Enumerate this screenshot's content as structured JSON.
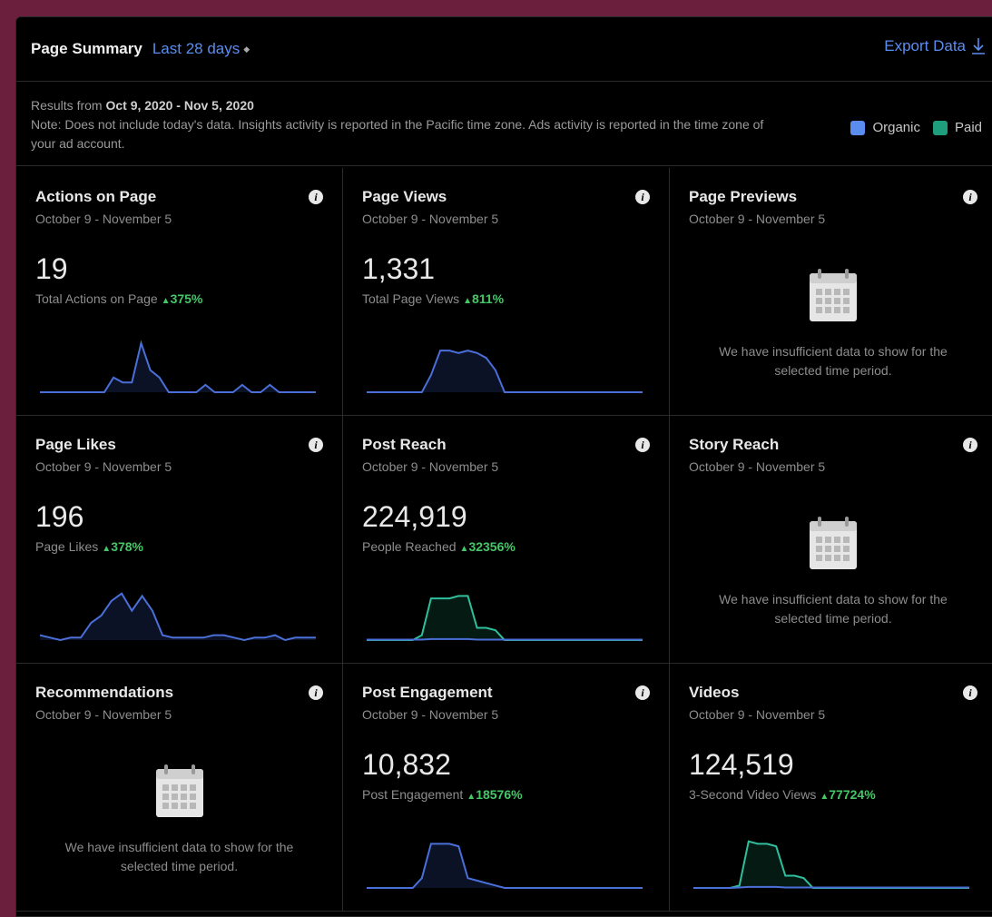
{
  "header": {
    "title": "Page Summary",
    "range_label": "Last 28 days",
    "export_label": "Export Data"
  },
  "notes": {
    "results_prefix": "Results from",
    "results_range": "Oct 9, 2020 - Nov 5, 2020",
    "note": "Note: Does not include today's data. Insights activity is reported in the Pacific time zone. Ads activity is reported in the time zone of your ad account."
  },
  "legend": [
    {
      "label": "Organic",
      "color": "#5b8def"
    },
    {
      "label": "Paid",
      "color": "#1e9e7d"
    }
  ],
  "colors": {
    "organic": "#4a6fd8",
    "paid": "#2fbf9d",
    "positive": "#44c767"
  },
  "cards": [
    {
      "title": "Actions on Page",
      "date": "October 9 - November 5",
      "value": "19",
      "metric": "Total Actions on Page",
      "change": "375%",
      "series": {
        "organic": [
          0,
          0,
          0,
          0,
          0,
          0,
          0,
          0,
          0.3,
          0.2,
          0.2,
          1,
          0.45,
          0.3,
          0,
          0,
          0,
          0,
          0.15,
          0,
          0,
          0,
          0.15,
          0,
          0,
          0.15,
          0,
          0,
          0,
          0,
          0
        ]
      }
    },
    {
      "title": "Page Views",
      "date": "October 9 - November 5",
      "value": "1,331",
      "metric": "Total Page Views",
      "change": "811%",
      "series": {
        "organic": [
          0,
          0,
          0,
          0,
          0,
          0,
          0,
          0.35,
          0.85,
          0.85,
          0.8,
          0.85,
          0.8,
          0.7,
          0.45,
          0,
          0,
          0,
          0,
          0,
          0,
          0,
          0,
          0,
          0,
          0,
          0,
          0,
          0,
          0,
          0
        ]
      }
    },
    {
      "title": "Page Previews",
      "date": "October 9 - November 5",
      "empty": "We have insufficient data to show for the selected time period."
    },
    {
      "title": "Page Likes",
      "date": "October 9 - November 5",
      "value": "196",
      "metric": "Page Likes",
      "change": "378%",
      "series": {
        "organic": [
          0.1,
          0.05,
          0,
          0.05,
          0.05,
          0.35,
          0.5,
          0.8,
          0.95,
          0.6,
          0.9,
          0.6,
          0.1,
          0.05,
          0.05,
          0.05,
          0.05,
          0.1,
          0.1,
          0.05,
          0,
          0.05,
          0.05,
          0.1,
          0,
          0.05,
          0.05,
          0.05
        ]
      }
    },
    {
      "title": "Post Reach",
      "date": "October 9 - November 5",
      "value": "224,919",
      "metric": "People Reached",
      "change": "32356%",
      "series": {
        "paid": [
          0,
          0,
          0,
          0,
          0,
          0,
          0.1,
          0.85,
          0.85,
          0.85,
          0.9,
          0.9,
          0.25,
          0.25,
          0.2,
          0,
          0,
          0,
          0,
          0,
          0,
          0,
          0,
          0,
          0,
          0,
          0,
          0,
          0,
          0,
          0
        ],
        "organic": [
          0.01,
          0.01,
          0.01,
          0.01,
          0.01,
          0.01,
          0.01,
          0.02,
          0.02,
          0.02,
          0.02,
          0.02,
          0.01,
          0.01,
          0.01,
          0.01,
          0.01,
          0.01,
          0.01,
          0.01,
          0.01,
          0.01,
          0.01,
          0.01,
          0.01,
          0.01,
          0.01,
          0.01,
          0.01,
          0.01,
          0.01
        ]
      }
    },
    {
      "title": "Story Reach",
      "date": "October 9 - November 5",
      "empty": "We have insufficient data to show for the selected time period."
    },
    {
      "title": "Recommendations",
      "date": "October 9 - November 5",
      "empty": "We have insufficient data to show for the selected time period."
    },
    {
      "title": "Post Engagement",
      "date": "October 9 - November 5",
      "value": "10,832",
      "metric": "Post Engagement",
      "change": "18576%",
      "series": {
        "organic": [
          0,
          0,
          0,
          0,
          0,
          0,
          0.2,
          0.9,
          0.9,
          0.9,
          0.85,
          0.2,
          0.15,
          0.1,
          0.05,
          0,
          0,
          0,
          0,
          0,
          0,
          0,
          0,
          0,
          0,
          0,
          0,
          0,
          0,
          0,
          0
        ]
      }
    },
    {
      "title": "Videos",
      "date": "October 9 - November 5",
      "value": "124,519",
      "metric": "3-Second Video Views",
      "change": "77724%",
      "series": {
        "paid": [
          0,
          0,
          0,
          0,
          0,
          0.05,
          0.95,
          0.9,
          0.9,
          0.85,
          0.25,
          0.25,
          0.2,
          0,
          0,
          0,
          0,
          0,
          0,
          0,
          0,
          0,
          0,
          0,
          0,
          0,
          0,
          0,
          0,
          0,
          0
        ],
        "organic": [
          0,
          0,
          0,
          0,
          0,
          0.01,
          0.02,
          0.02,
          0.02,
          0.02,
          0.01,
          0.01,
          0.01,
          0.01,
          0.01,
          0.01,
          0.01,
          0.01,
          0.01,
          0.01,
          0.01,
          0.01,
          0.01,
          0.01,
          0.01,
          0.01,
          0.01,
          0.01,
          0.01,
          0.01,
          0.01
        ]
      }
    }
  ]
}
